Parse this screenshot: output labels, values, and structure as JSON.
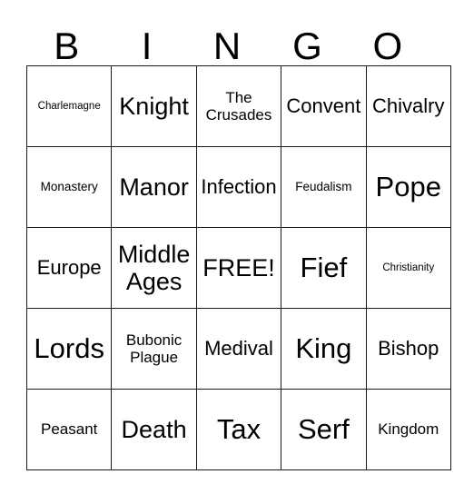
{
  "card": {
    "title_letters": [
      "B",
      "I",
      "N",
      "G",
      "O"
    ],
    "free_space_label": "FREE!",
    "colors": {
      "border": "#1a1a1a",
      "cell_background": "#ffffff",
      "text": "#000000"
    },
    "rows": [
      [
        {
          "label": "Charlemagne",
          "size": "xxs"
        },
        {
          "label": "Knight",
          "size": "lg"
        },
        {
          "label": "The Crusades",
          "size": "sm"
        },
        {
          "label": "Convent",
          "size": "md"
        },
        {
          "label": "Chivalry",
          "size": "md"
        }
      ],
      [
        {
          "label": "Monastery",
          "size": "xs"
        },
        {
          "label": "Manor",
          "size": "lg"
        },
        {
          "label": "Infection",
          "size": "md"
        },
        {
          "label": "Feudalism",
          "size": "xs"
        },
        {
          "label": "Pope",
          "size": "xl"
        }
      ],
      [
        {
          "label": "Europe",
          "size": "md"
        },
        {
          "label": "Middle Ages",
          "size": "lg"
        },
        {
          "label": "FREE!",
          "size": "lg"
        },
        {
          "label": "Fief",
          "size": "xl"
        },
        {
          "label": "Christianity",
          "size": "xxs"
        }
      ],
      [
        {
          "label": "Lords",
          "size": "xl"
        },
        {
          "label": "Bubonic Plague",
          "size": "sm"
        },
        {
          "label": "Medival",
          "size": "md"
        },
        {
          "label": "King",
          "size": "xl"
        },
        {
          "label": "Bishop",
          "size": "md"
        }
      ],
      [
        {
          "label": "Peasant",
          "size": "sm"
        },
        {
          "label": "Death",
          "size": "lg"
        },
        {
          "label": "Tax",
          "size": "xl"
        },
        {
          "label": "Serf",
          "size": "xl"
        },
        {
          "label": "Kingdom",
          "size": "sm"
        }
      ]
    ]
  }
}
